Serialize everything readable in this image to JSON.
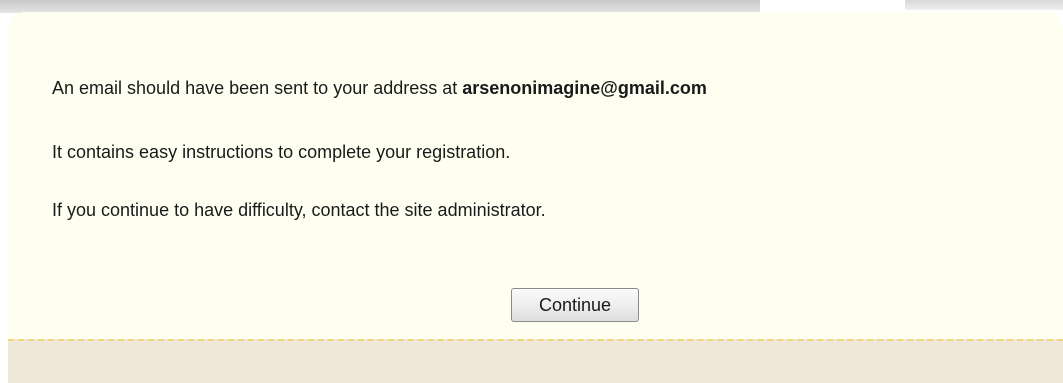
{
  "message": {
    "line1_prefix": "An email should have been sent to your address at ",
    "email": "arsenonimagine@gmail.com",
    "line2": "It contains easy instructions to complete your registration.",
    "line3": "If you continue to have difficulty, contact the site administrator."
  },
  "actions": {
    "continue_label": "Continue"
  },
  "colors": {
    "panel_background": "#fefff0",
    "footer_background": "#efe8d8",
    "footer_border": "#efd77a"
  }
}
